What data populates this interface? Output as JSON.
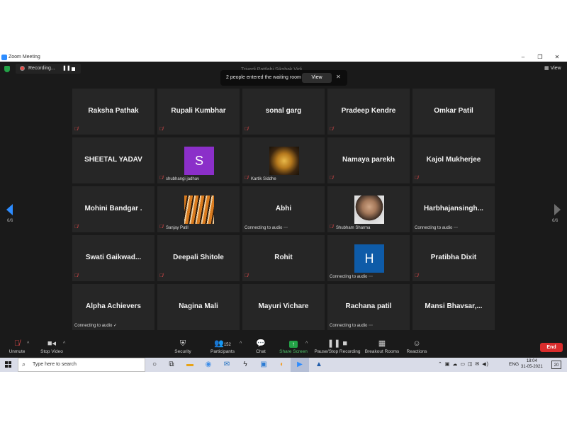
{
  "window": {
    "title": "Zoom Meeting",
    "minimize": "–",
    "restore": "❐",
    "close": "✕"
  },
  "meeting": {
    "topic": "Trivedi Pattlahi Sikshak Vidi",
    "recording_label": "Recording...",
    "pause_symbol": "❚❚",
    "view_label": "View"
  },
  "notification": {
    "text": "2 people entered the waiting room",
    "button": "View",
    "close": "✕"
  },
  "navigation": {
    "page_left": "6/6",
    "page_right": "6/6"
  },
  "tiles": [
    {
      "name": "Raksha Pathak",
      "muted": true
    },
    {
      "name": "Rupali Kumbhar",
      "muted": true
    },
    {
      "name": "sonal garg",
      "muted": true
    },
    {
      "name": "Pradeep Kendre",
      "muted": true
    },
    {
      "name": "Omkar Patil",
      "muted": false
    },
    {
      "name": "SHEETAL YADAV",
      "muted": false
    },
    {
      "label": "shubhangi jadhav",
      "avatar": "S",
      "avatar_color": "#8b2fc9",
      "muted": true
    },
    {
      "label": "Kartik Siddhe",
      "photo": "idol",
      "muted": true
    },
    {
      "name": "Namaya parekh",
      "muted": true
    },
    {
      "name": "Kajol Mukherjee",
      "muted": true
    },
    {
      "name": "Mohini Bandgar .",
      "muted": true
    },
    {
      "label": "Sanjay Patil",
      "photo": "tiger",
      "muted": true
    },
    {
      "name": "Abhi",
      "status": "Connecting to audio ⋯"
    },
    {
      "label": "Shubham Sharma",
      "photo": "man",
      "muted": true
    },
    {
      "name": "Harbhajansingh...",
      "status": "Connecting to audio ⋯"
    },
    {
      "name": "Swati  Gaikwad...",
      "muted": true
    },
    {
      "name": "Deepali Shitole",
      "muted": true
    },
    {
      "name": "Rohit",
      "muted": true
    },
    {
      "avatar": "H",
      "avatar_color": "#0e5ba8",
      "status": "Connecting to audio ⋯"
    },
    {
      "name": "Pratibha Dixit",
      "muted": true
    },
    {
      "name": "Alpha Achievers",
      "status": "Connecting to audio ✓"
    },
    {
      "name": "Nagina Mali"
    },
    {
      "name": "Mayuri Vichare"
    },
    {
      "name": "Rachana patil",
      "status": "Connecting to audio ⋯"
    },
    {
      "name": "Mansi  Bhavsar,..."
    }
  ],
  "toolbar": {
    "unmute": "Unmute",
    "stop_video": "Stop Video",
    "security": "Security",
    "participants": "Participants",
    "participants_count": "152",
    "chat": "Chat",
    "share_screen": "Share Screen",
    "recording": "Pause/Stop Recording",
    "breakout": "Breakout Rooms",
    "reactions": "Reactions",
    "end": "End"
  },
  "colors": {
    "share_green": "#23a247",
    "end_red": "#d92c2c",
    "accent_blue": "#2d8cff"
  },
  "taskbar": {
    "search_placeholder": "Type here to search",
    "language": "ENG",
    "time": "18:04",
    "date": "31-05-2021",
    "notifications": "20"
  }
}
